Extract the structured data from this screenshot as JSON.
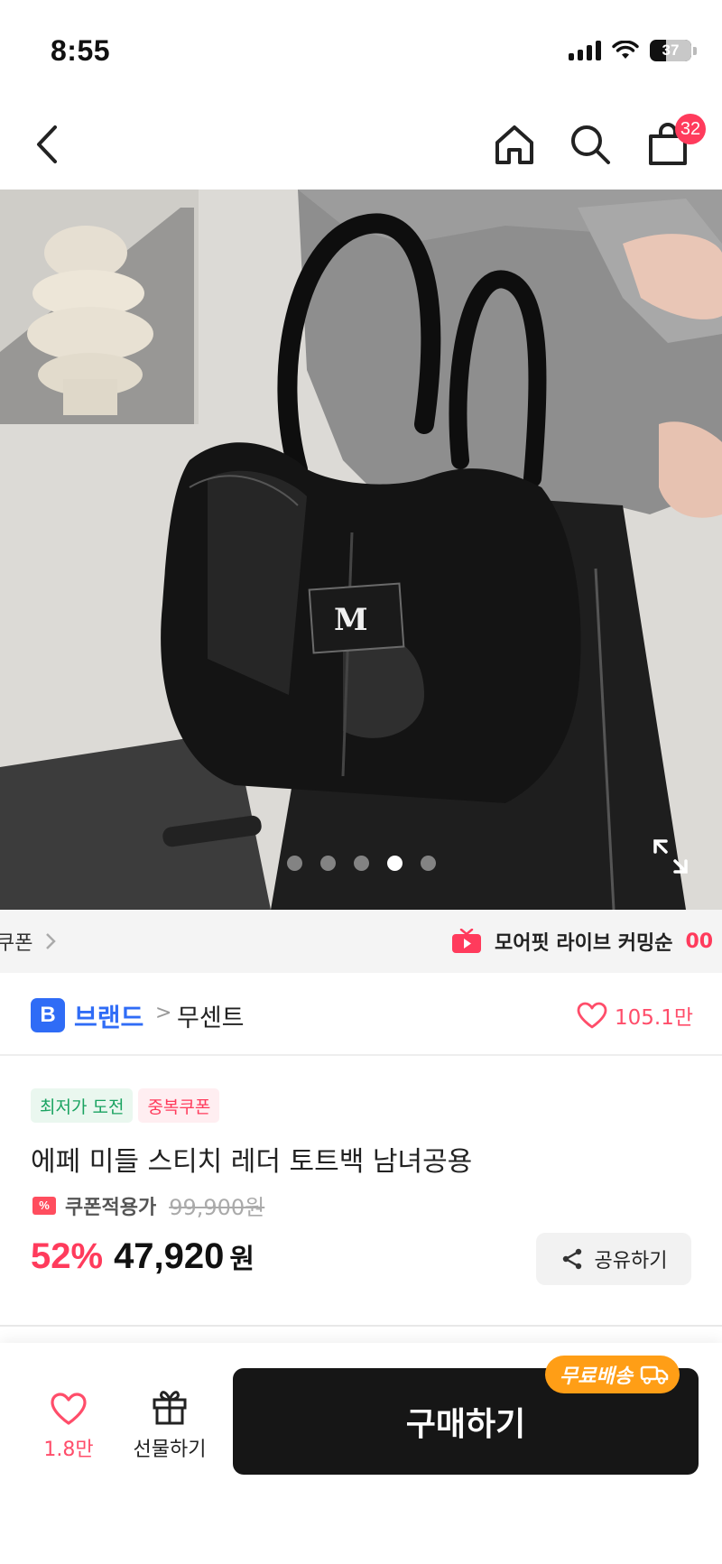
{
  "status_bar": {
    "time": "8:55",
    "battery": "37"
  },
  "nav": {
    "cart_count": "32"
  },
  "carousel": {
    "total": 5,
    "active_index": 3
  },
  "promo": {
    "coupon_label": "쿠폰",
    "live_label": "모어핏 라이브 커밍순",
    "live_count": "00"
  },
  "brand": {
    "badge": "B",
    "label": "브랜드",
    "separator": ">",
    "name": "무센트",
    "likes": "105.1만"
  },
  "product": {
    "tags": [
      "최저가 도전",
      "중복쿠폰"
    ],
    "title": "에페 미들 스티치 레더 토트백 남녀공용",
    "coupon_label": "쿠폰적용가",
    "original_price": "99,900원",
    "discount": "52%",
    "price": "47,920",
    "price_unit": "원",
    "share_label": "공유하기"
  },
  "bottom_bar": {
    "wish_count": "1.8만",
    "gift_label": "선물하기",
    "buy_label": "구매하기",
    "free_shipping": "무료배송"
  },
  "colors": {
    "accent": "#ff3b5c",
    "brand_blue": "#2f6cf6",
    "buy_button": "#161616",
    "free_shipping": "#ff9e16"
  },
  "icons": {
    "back": "chevron-left-icon",
    "home": "home-icon",
    "search": "search-icon",
    "cart": "shopping-bag-icon",
    "expand": "expand-icon",
    "live": "live-tv-icon",
    "heart": "heart-icon",
    "share": "share-icon",
    "gift": "gift-icon",
    "truck": "truck-icon"
  }
}
